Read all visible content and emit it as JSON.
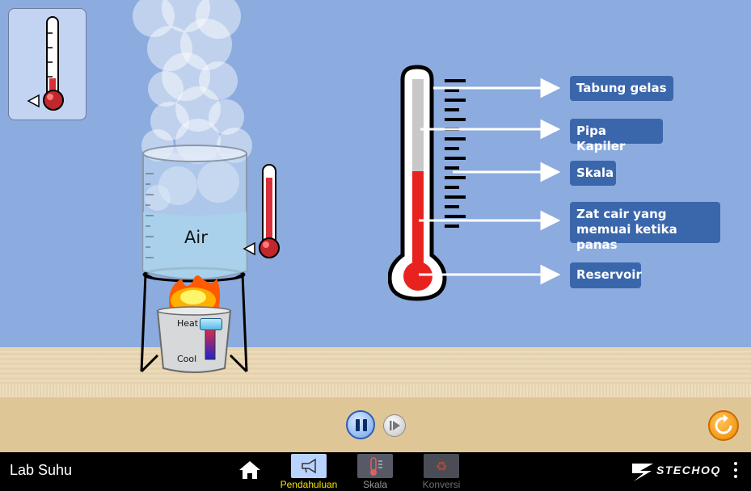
{
  "app": {
    "title": "Lab Suhu",
    "brand": "STECHOQ"
  },
  "beaker": {
    "label": "Air"
  },
  "burner": {
    "heat_label": "Heat",
    "cool_label": "Cool"
  },
  "diagram_labels": [
    {
      "id": "tabung",
      "text": "Tabung gelas"
    },
    {
      "id": "pipa",
      "text": "Pipa Kapiler"
    },
    {
      "id": "skala",
      "text": "Skala"
    },
    {
      "id": "zat",
      "text": "Zat cair yang memuai ketika panas"
    },
    {
      "id": "reservoir",
      "text": "Reservoir"
    }
  ],
  "nav": {
    "tabs": [
      {
        "label": "Pendahuluan",
        "active": true,
        "color": "#f5e400"
      },
      {
        "label": "Skala",
        "active": false,
        "color": "#9a9a9a"
      },
      {
        "label": "Konversi",
        "active": false,
        "color": "#6e6e6e"
      }
    ]
  },
  "colors": {
    "sky": "#8cabdf",
    "label_bg": "#3a66ac",
    "mercury": "#e8231f",
    "active_tab": "#f5e400"
  }
}
